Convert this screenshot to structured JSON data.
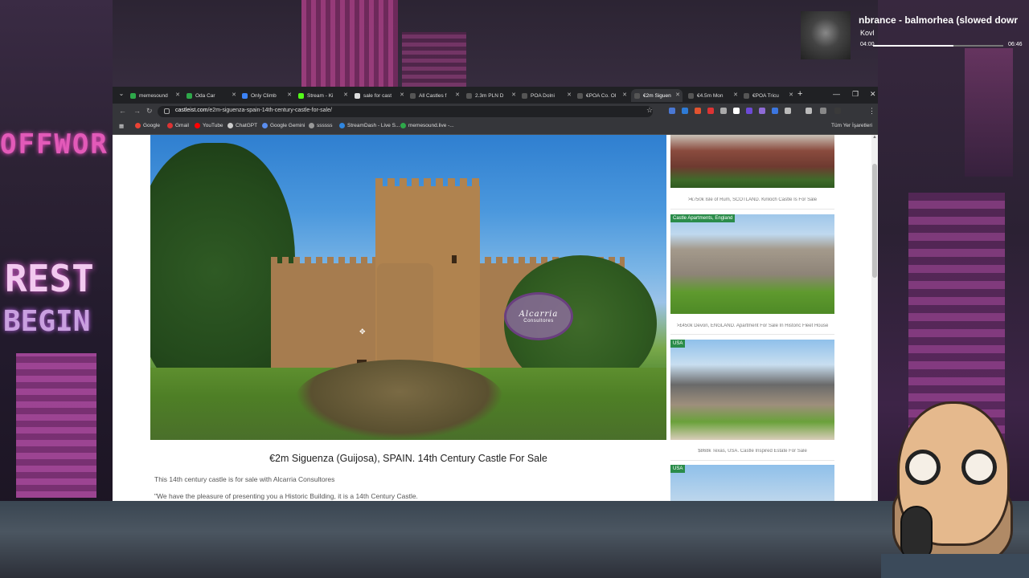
{
  "music": {
    "title": "nbrance - balmorhea (slowed dowr",
    "artist": "Kovl",
    "time_current": "04:00",
    "time_total": "06:46",
    "progress": 0.62
  },
  "browser": {
    "tabs": [
      {
        "label": "memesound"
      },
      {
        "label": "Oda Car"
      },
      {
        "label": "Only Climb"
      },
      {
        "label": "Stream - Ki"
      },
      {
        "label": "sale for cast"
      },
      {
        "label": "All Castles f"
      },
      {
        "label": "2.3m PLN D"
      },
      {
        "label": "POA Dolni"
      },
      {
        "label": "€POA Co. Ol"
      },
      {
        "label": "€2m Siguen"
      },
      {
        "label": "€4.5m Mon"
      },
      {
        "label": "€POA Tricu"
      }
    ],
    "url_host": "castleist.com",
    "url_path": "/e2m-siguenza-spain-14th-century-castle-for-sale/",
    "bookmarks": [
      {
        "label": "Google"
      },
      {
        "label": "Gmail"
      },
      {
        "label": "YouTube"
      },
      {
        "label": "ChatGPT"
      },
      {
        "label": "Google Gemini"
      },
      {
        "label": "ssssss"
      },
      {
        "label": "StreamDash - Live S..."
      },
      {
        "label": "memesound.live -..."
      }
    ],
    "bookmarks_folder": "Tüm Yer İşaretleri"
  },
  "page": {
    "watermark_line1": "Alcarria",
    "watermark_line2": "Consultores",
    "listing_title": "€2m Siguenza (Guijosa), SPAIN.  14th Century Castle For Sale",
    "para1": "This 14th century castle is for sale with Alcarria Consultores",
    "para2": "\"We have the pleasure of presenting you a Historic Building, it is a 14th Century Castle."
  },
  "sidebar_cards": [
    {
      "tag": "",
      "caption": ">€750k Isle of Rum, SCOTLAND. Kinloch Castle Is For Sale"
    },
    {
      "tag": "Castle Apartments, England",
      "caption": ">£450k Devon, ENGLAND. Apartment For Sale In Historic Fleet House"
    },
    {
      "tag": "USA",
      "caption": "$868k Texas, USA. Castle Inspired Estate For Sale"
    },
    {
      "tag": "USA",
      "caption": ""
    }
  ]
}
